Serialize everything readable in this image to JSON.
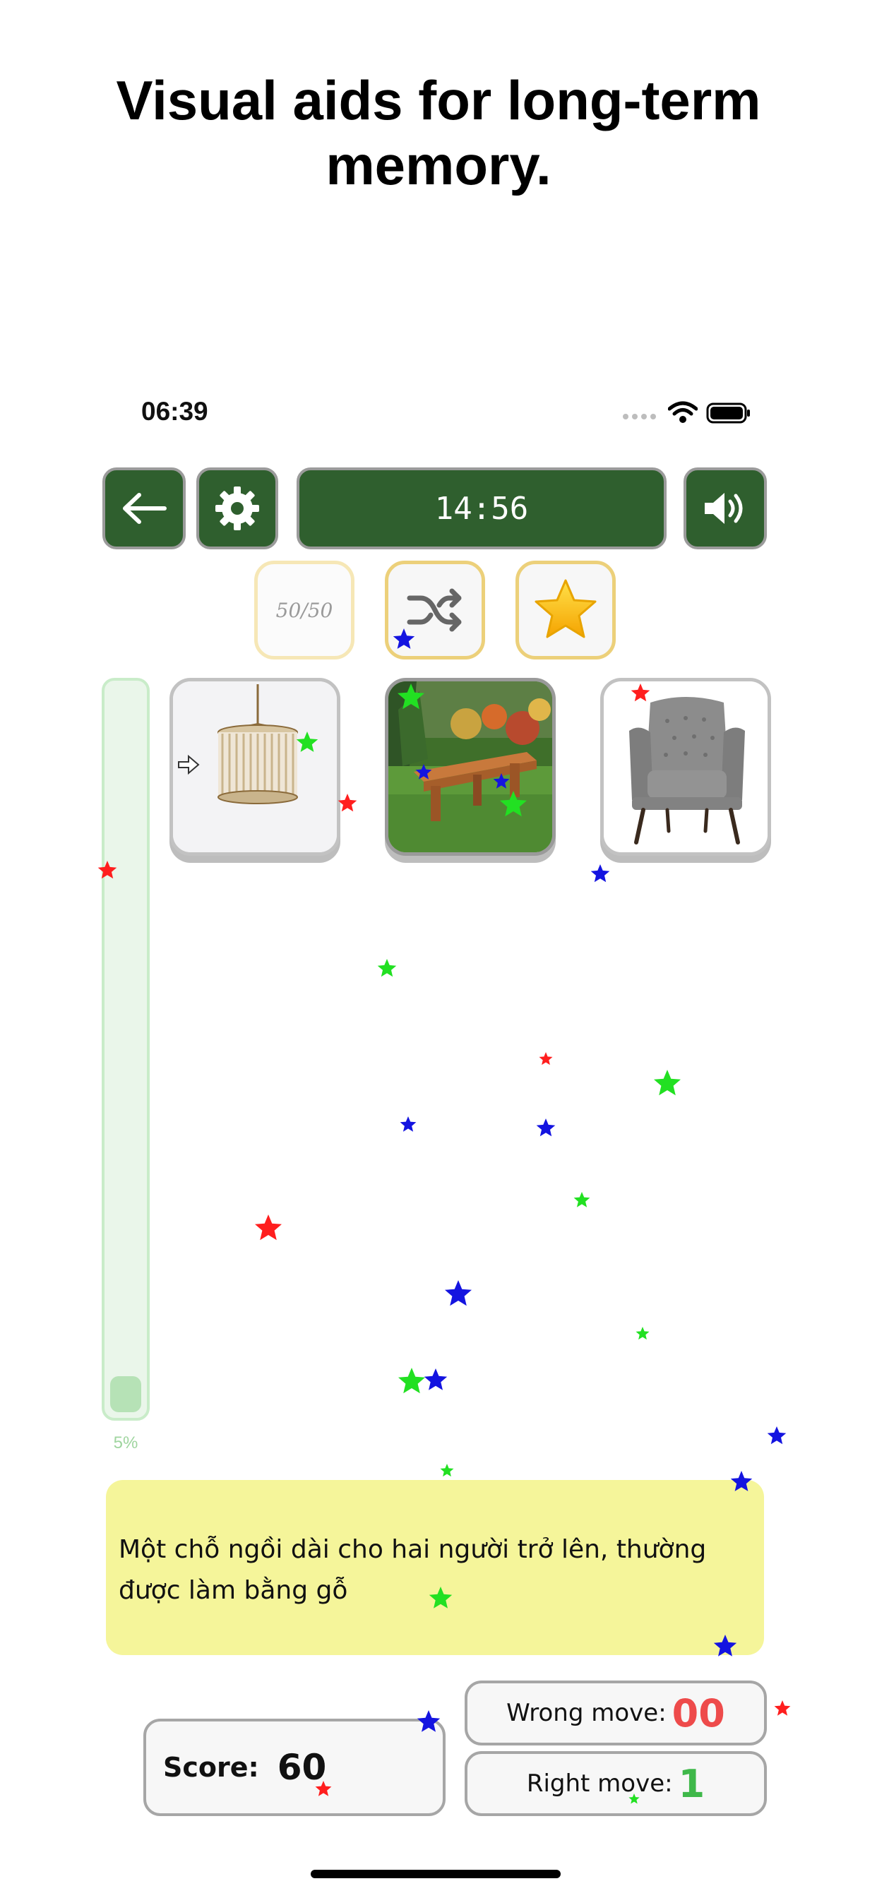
{
  "headline": {
    "line1": "Visual aids for long-term",
    "line2": "memory."
  },
  "status_bar": {
    "time": "06:39",
    "icons": [
      "signal-icon",
      "wifi-icon",
      "battery-icon"
    ]
  },
  "controls": {
    "back_icon": "arrow-left-icon",
    "settings_icon": "gear-icon",
    "timer": "14:56",
    "sound_icon": "speaker-icon"
  },
  "powerups": {
    "fifty_fifty": "50/50",
    "shuffle_icon": "shuffle-icon",
    "star_icon": "star-icon"
  },
  "progress": {
    "label": "5%",
    "value": 0.05
  },
  "cards": [
    {
      "name": "chandelier",
      "icon": "chandelier-image"
    },
    {
      "name": "bench",
      "icon": "bench-image"
    },
    {
      "name": "armchair",
      "icon": "armchair-image"
    }
  ],
  "clue": {
    "line1": "Một chỗ ngồi dài cho hai người trở lên, thường",
    "line2": "được làm bằng gỗ"
  },
  "score": {
    "label": "Score:",
    "value": "60"
  },
  "moves": {
    "wrong_label": "Wrong move:",
    "wrong_value": "00",
    "right_label": "Right move:",
    "right_value": "1"
  },
  "colors": {
    "control_green": "#2f5f2e",
    "clue_yellow": "#f5f59a",
    "wrong_red": "#ee4b4b",
    "right_green": "#3fb84a"
  }
}
